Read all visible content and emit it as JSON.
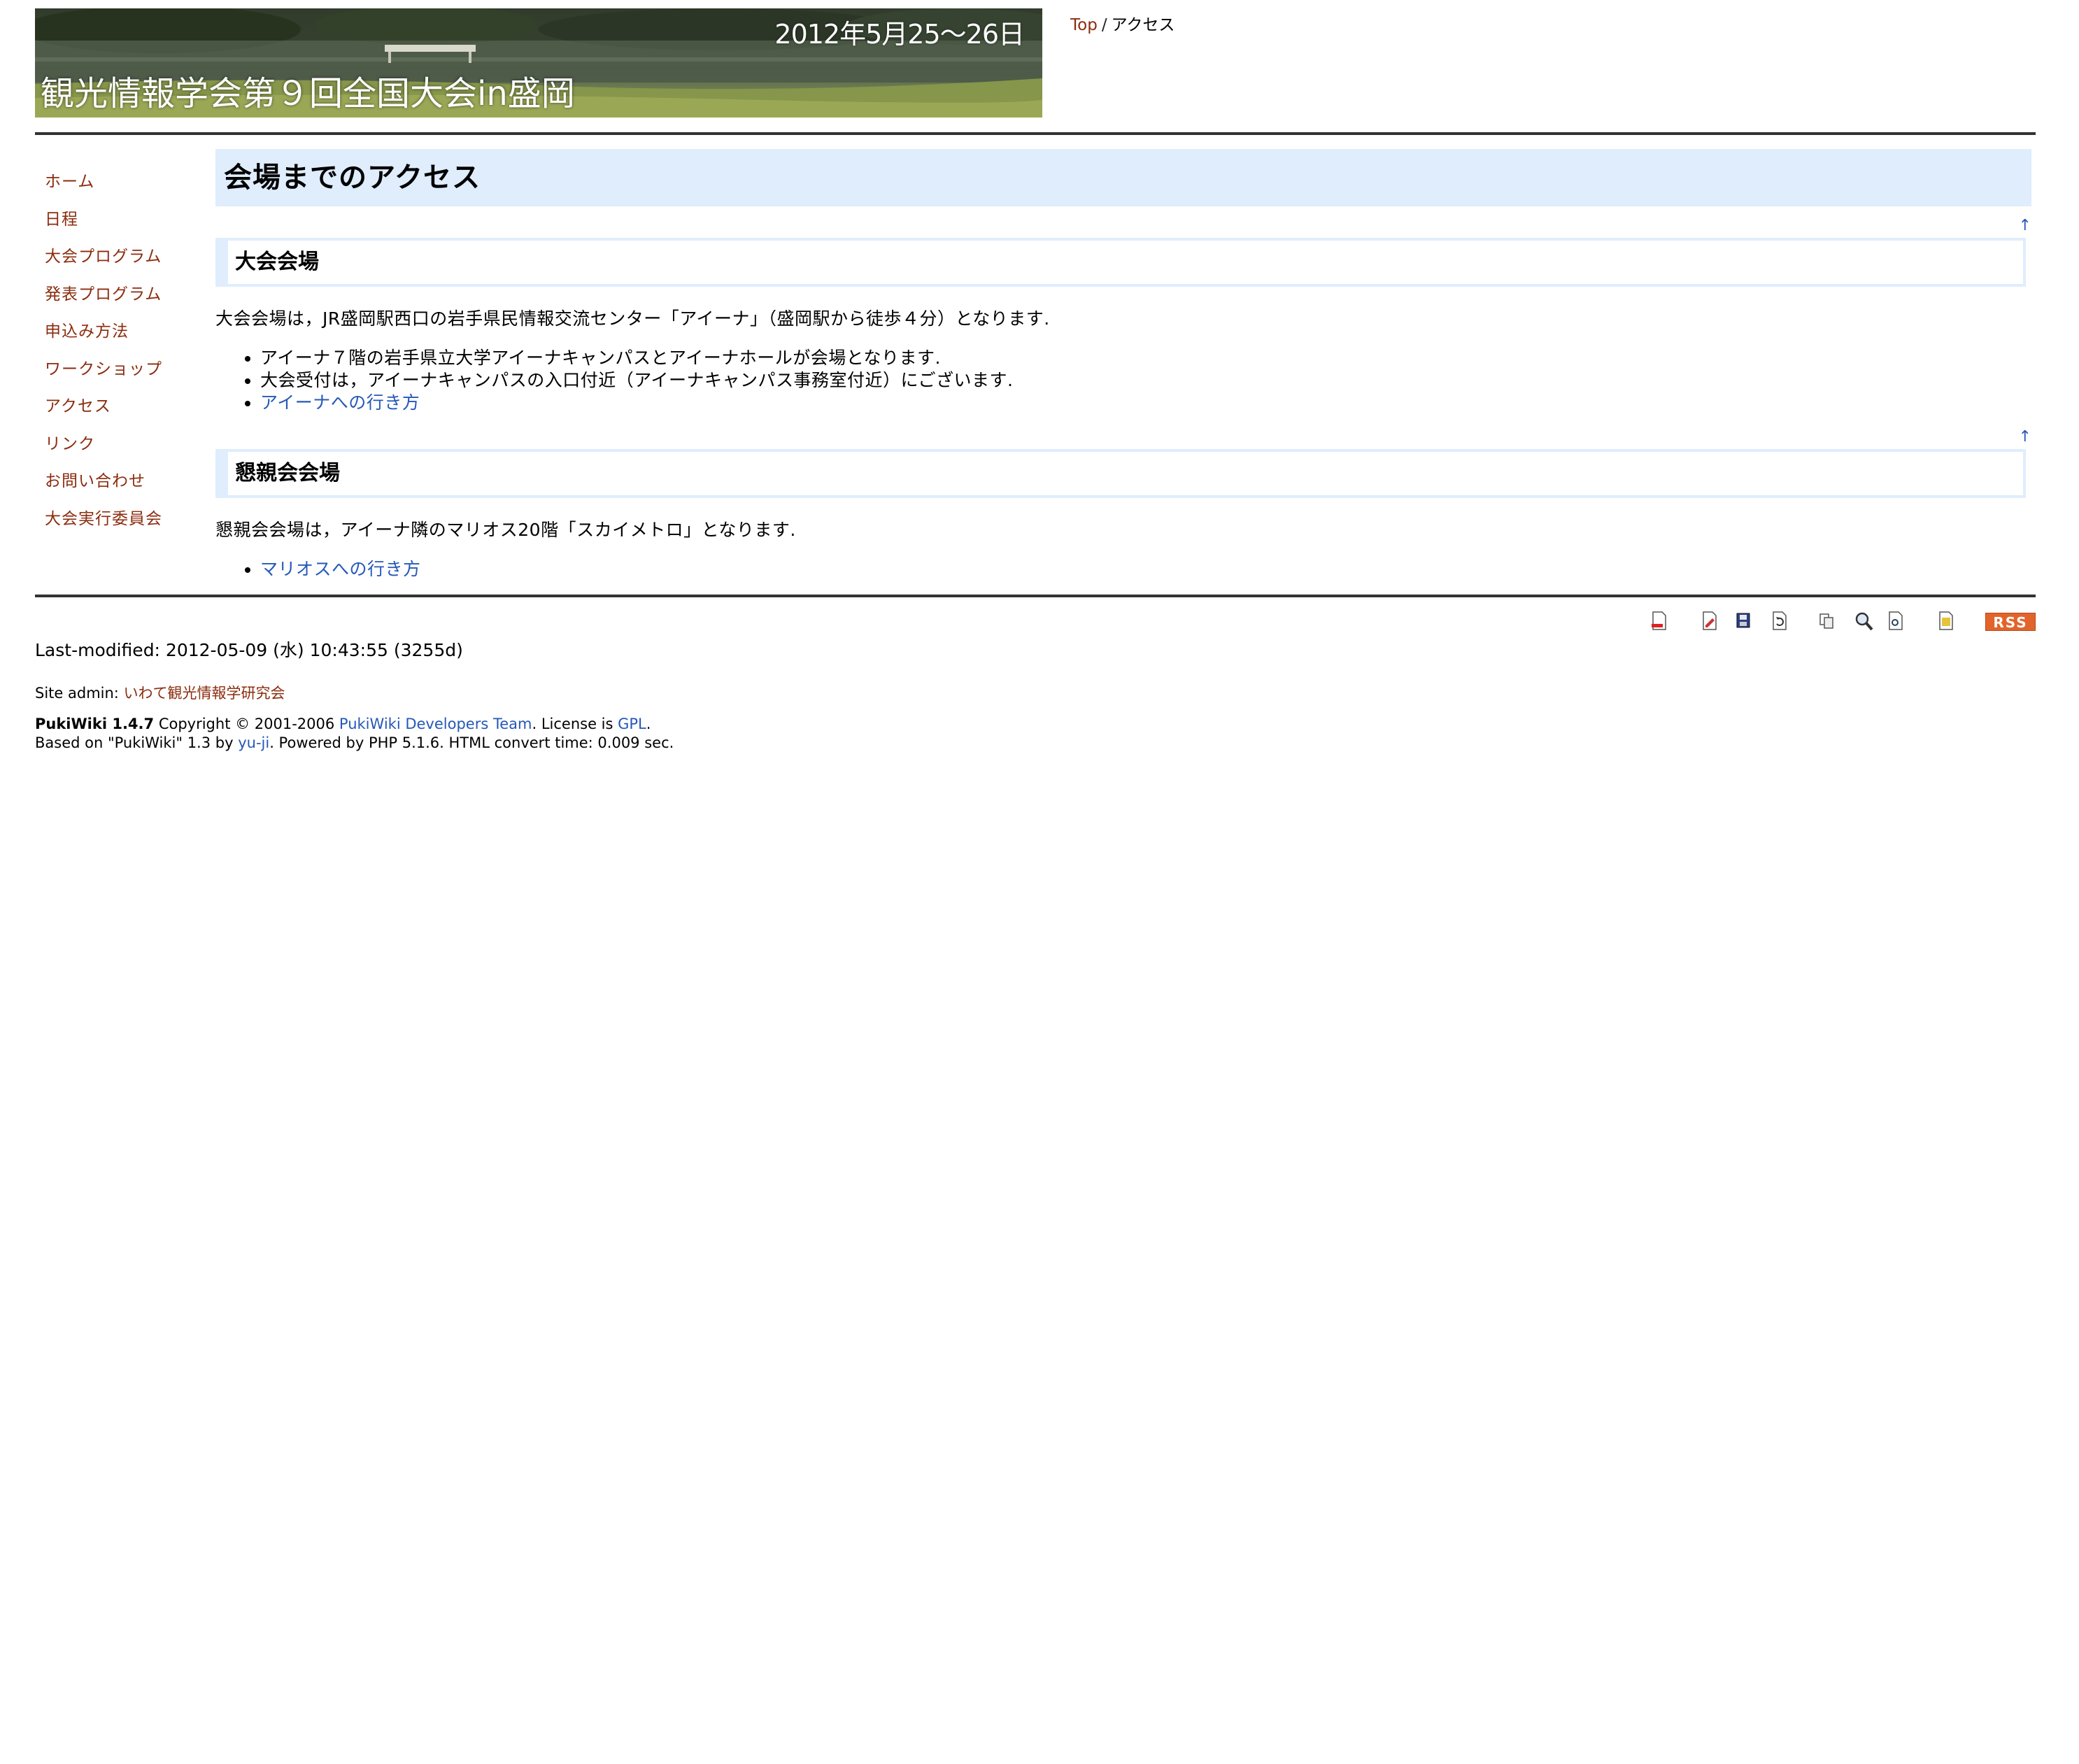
{
  "header": {
    "banner_date": "2012年5月25〜26日",
    "banner_title": "観光情報学会第９回全国大会in盛岡",
    "breadcrumb": {
      "top_link": "Top",
      "separator": "/",
      "current": "アクセス"
    }
  },
  "menubar": {
    "items": [
      {
        "label": "ホーム"
      },
      {
        "label": "日程"
      },
      {
        "label": "大会プログラム"
      },
      {
        "label": "発表プログラム"
      },
      {
        "label": "申込み方法"
      },
      {
        "label": "ワークショップ"
      },
      {
        "label": "アクセス"
      },
      {
        "label": "リンク"
      },
      {
        "label": "お問い合わせ"
      },
      {
        "label": "大会実行委員会"
      }
    ]
  },
  "body": {
    "page_heading": "会場までのアクセス",
    "up_arrow": "↑",
    "sections": [
      {
        "heading": "大会会場",
        "paragraph": "大会会場は，JR盛岡駅西口の岩手県民情報交流センター「アイーナ」（盛岡駅から徒歩４分）となります.",
        "items": [
          "アイーナ７階の岩手県立大学アイーナキャンパスとアイーナホールが会場となります.",
          "大会受付は，アイーナキャンパスの入口付近（アイーナキャンパス事務室付近）にございます."
        ],
        "link": "アイーナへの行き方"
      },
      {
        "heading": "懇親会会場",
        "paragraph": "懇親会会場は，アイーナ隣のマリオス20階「スカイメトロ」となります.",
        "link": "マリオスへの行き方"
      }
    ]
  },
  "toolbar": {
    "icons": [
      "new-page-icon",
      "edit-icon",
      "backup-icon",
      "diff-icon",
      "copy-icon",
      "search-icon",
      "list-icon",
      "help-icon"
    ],
    "rss_label": "RSS"
  },
  "footer": {
    "last_modified": "Last-modified: 2012-05-09 (水) 10:43:55 (3255d)",
    "site_admin_label": "Site admin:",
    "site_admin_link": "いわて観光情報学研究会",
    "pukiwiki_version": "PukiWiki 1.4.7",
    "copyright_text": " Copyright © 2001-2006 ",
    "developers_link": "PukiWiki Developers Team",
    "license_text": ". License is ",
    "license_link": "GPL",
    "license_end": ".",
    "based_on_text": "Based on \"PukiWiki\" 1.3 by ",
    "author_link": "yu-ji",
    "powered_text": ". Powered by PHP 5.1.6. HTML convert time: 0.009 sec."
  },
  "colors": {
    "menu_link": "#8b2c0e",
    "content_link": "#2558b8",
    "heading_bg": "#dfedfd",
    "rss_bg": "#e2642b"
  }
}
